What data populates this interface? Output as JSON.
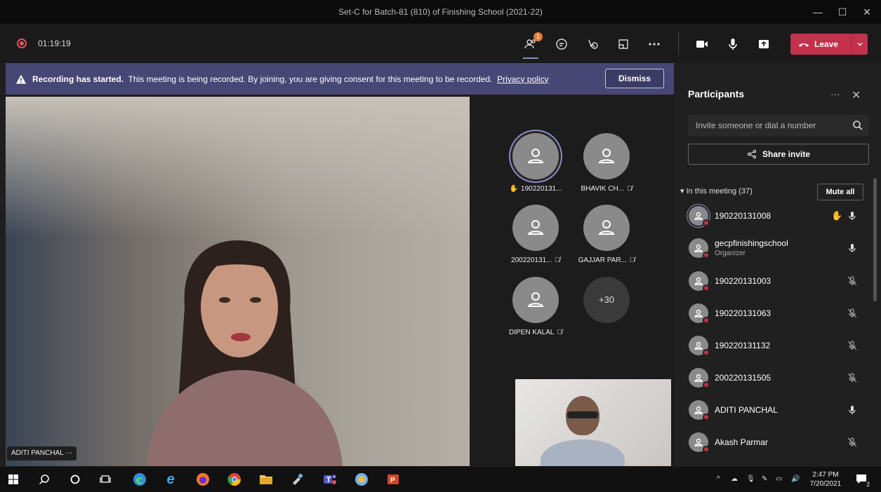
{
  "window": {
    "title": "Set-C for Batch-81 (810) of Finishing School (2021-22)"
  },
  "meeting": {
    "timer": "01:19:19",
    "participants_badge": "1",
    "leave_label": "Leave"
  },
  "banner": {
    "title": "Recording has started.",
    "message": "This meeting is being recorded. By joining, you are giving consent for this meeting to be recorded.",
    "link": "Privacy policy",
    "dismiss_label": "Dismiss"
  },
  "stage": {
    "speaker_name": "ADITI PANCHAL",
    "speaker_more": "···",
    "tiles": [
      {
        "name": "190220131..."
      },
      {
        "name": "BHAVIK CH..."
      },
      {
        "name": "200220131..."
      },
      {
        "name": "GAJJAR PAR..."
      },
      {
        "name": "DIPEN KALAL"
      }
    ],
    "more_count": "+30"
  },
  "panel": {
    "title": "Participants",
    "more": "···",
    "close": "✕",
    "invite_placeholder": "Invite someone or dial a number",
    "share_label": "Share invite",
    "section_label": "In this meeting (37)",
    "mute_all_label": "Mute all",
    "participants": [
      {
        "name": "190220131008",
        "role": ""
      },
      {
        "name": "gecpfinishingschool",
        "role": "Organizer"
      },
      {
        "name": "190220131003",
        "role": ""
      },
      {
        "name": "190220131063",
        "role": ""
      },
      {
        "name": "190220131132",
        "role": ""
      },
      {
        "name": "200220131505",
        "role": ""
      },
      {
        "name": "ADITI PANCHAL",
        "role": ""
      },
      {
        "name": "Akash Parmar",
        "role": ""
      }
    ]
  },
  "taskbar": {
    "time": "2:47 PM",
    "date": "7/20/2021",
    "notification_count": "2"
  },
  "colors": {
    "accent": "#8b8cc7",
    "banner": "#464775",
    "leave": "#c4314b",
    "hand": "#f0b429"
  }
}
